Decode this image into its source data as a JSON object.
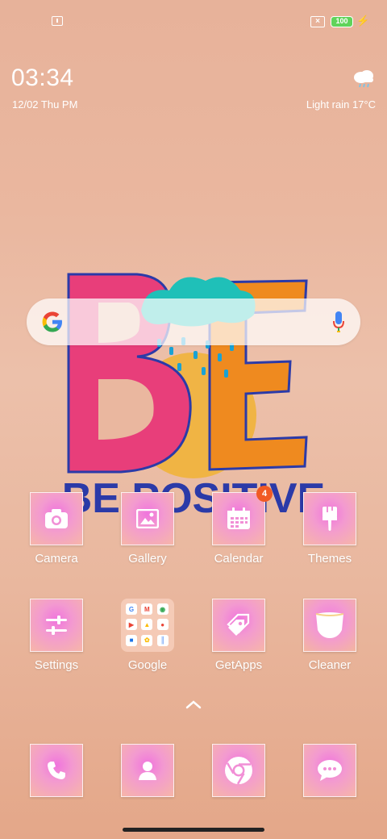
{
  "status_bar": {
    "battery": "100"
  },
  "clock": {
    "time": "03:34",
    "date": "12/02 Thu PM"
  },
  "weather": {
    "text": "Light rain 17°C",
    "icon": "cloud-rain-icon"
  },
  "wallpaper": {
    "art_text": "BE POSITIVE"
  },
  "search": {
    "icon": "google-logo",
    "mic_icon": "mic-icon"
  },
  "apps": {
    "row1": [
      {
        "label": "Camera",
        "icon": "camera-icon"
      },
      {
        "label": "Gallery",
        "icon": "image-icon"
      },
      {
        "label": "Calendar",
        "icon": "calendar-icon",
        "badge": "4"
      },
      {
        "label": "Themes",
        "icon": "paintbrush-icon"
      }
    ],
    "row2": [
      {
        "label": "Settings",
        "icon": "sliders-icon"
      },
      {
        "label": "Google",
        "icon": "folder-icon"
      },
      {
        "label": "GetApps",
        "icon": "tag-icon"
      },
      {
        "label": "Cleaner",
        "icon": "cleaner-icon"
      }
    ]
  },
  "dock": [
    {
      "icon": "phone-icon"
    },
    {
      "icon": "contact-icon"
    },
    {
      "icon": "chrome-icon"
    },
    {
      "icon": "message-icon"
    }
  ],
  "colors": {
    "badge": "#f15a24",
    "battery": "#5fd35a",
    "icon_pink": "#f074dd"
  }
}
